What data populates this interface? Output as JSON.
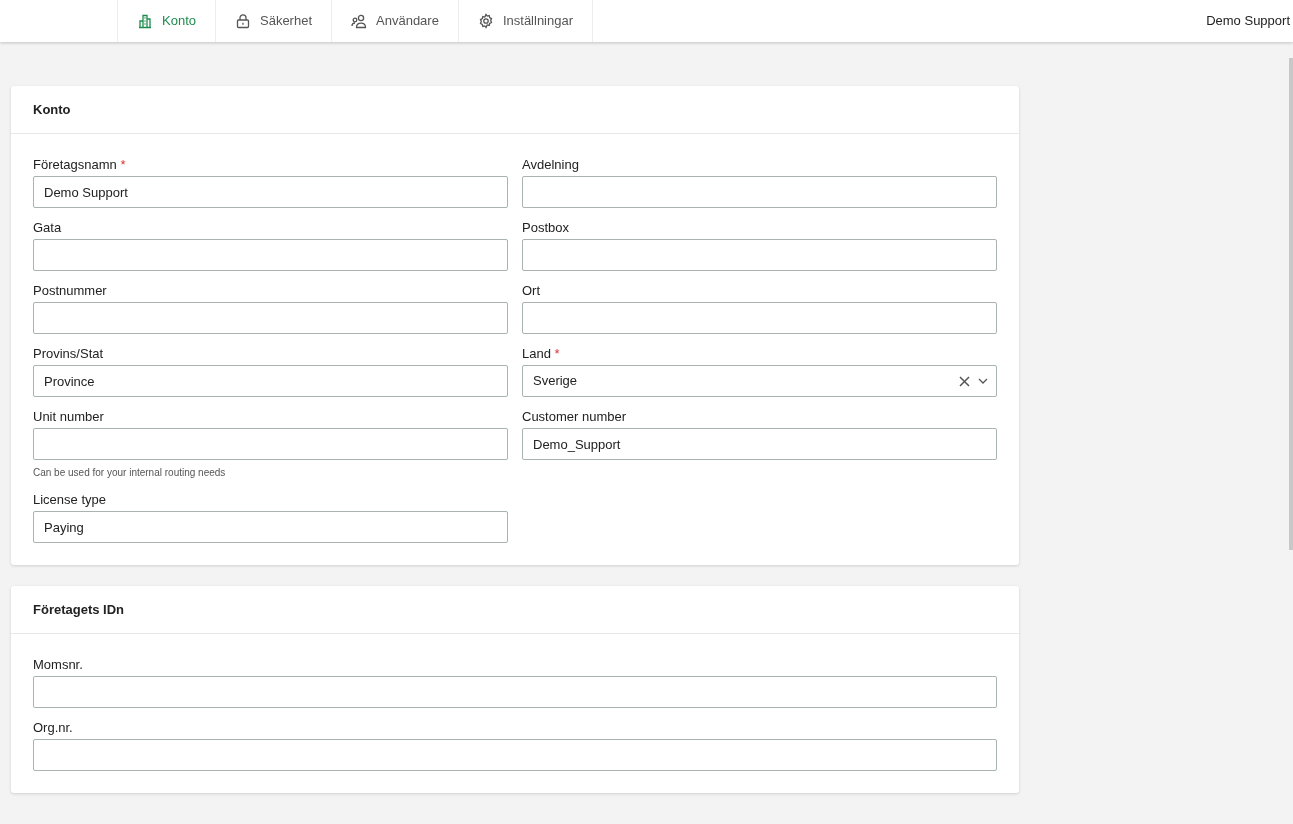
{
  "nav": {
    "tabs": [
      {
        "label": "Konto",
        "selected": true
      },
      {
        "label": "Säkerhet",
        "selected": false
      },
      {
        "label": "Användare",
        "selected": false
      },
      {
        "label": "Inställningar",
        "selected": false
      }
    ],
    "user": "Demo Support"
  },
  "cards": [
    {
      "title": "Konto",
      "fields": [
        {
          "label": "Företagsnamn",
          "required_mark": "*",
          "kind": "text",
          "value": "Demo Support"
        },
        {
          "label": "Avdelning",
          "kind": "text"
        },
        {
          "label": "Gata",
          "kind": "text"
        },
        {
          "label": "Postbox",
          "kind": "text"
        },
        {
          "label": "Postnummer",
          "kind": "text"
        },
        {
          "label": "Ort",
          "kind": "text"
        },
        {
          "label": "Provins/Stat",
          "kind": "text",
          "value": "Province"
        },
        {
          "label": "Land",
          "required_mark": "*",
          "kind": "select",
          "value": "Sverige"
        },
        {
          "label": "Unit number",
          "kind": "text",
          "hint": "Can be used for your internal routing needs"
        },
        {
          "label": "Customer number",
          "kind": "text",
          "value": "Demo_Support"
        },
        {
          "label": "License type",
          "kind": "text",
          "value": "Paying"
        }
      ]
    },
    {
      "title": "Företagets IDn",
      "fields": [
        {
          "label": "Momsnr.",
          "kind": "text"
        },
        {
          "label": "Org.nr.",
          "kind": "text"
        }
      ]
    }
  ]
}
